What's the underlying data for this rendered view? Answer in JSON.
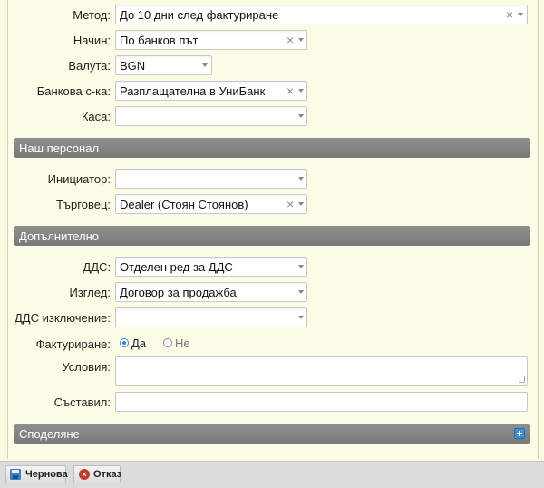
{
  "payment": {
    "method": {
      "label": "Метод:",
      "value": "До 10 дни след фактуриране"
    },
    "way": {
      "label": "Начин:",
      "value": "По банков път"
    },
    "currency": {
      "label": "Валута:",
      "value": "BGN"
    },
    "bank_account": {
      "label": "Банкова с-ка:",
      "value": "Разплащателна в УниБанк"
    },
    "cashbox": {
      "label": "Каса:",
      "value": ""
    }
  },
  "staff_section": {
    "title": "Наш персонал",
    "initiator": {
      "label": "Инициатор:",
      "value": ""
    },
    "dealer": {
      "label": "Търговец:",
      "value": "Dealer (Стоян Стоянов)"
    }
  },
  "extra_section": {
    "title": "Допълнително",
    "vat": {
      "label": "ДДС:",
      "value": "Отделен ред за ДДС"
    },
    "view": {
      "label": "Изглед:",
      "value": "Договор за продажба"
    },
    "vat_exemption": {
      "label": "ДДС изключение:",
      "value": ""
    },
    "invoicing": {
      "label": "Фактуриране:",
      "yes": "Да",
      "no": "Не",
      "selected": "yes"
    },
    "conditions": {
      "label": "Условия:",
      "value": ""
    },
    "author": {
      "label": "Съставил:",
      "value": ""
    }
  },
  "sharing_section": {
    "title": "Споделяне"
  },
  "footer": {
    "draft_label": "Чернова",
    "cancel_label": "Отказ"
  },
  "icons": {
    "clear": "×",
    "cancel_glyph": "×"
  },
  "colors": {
    "background": "#fcfbe6",
    "section_header": "#858585",
    "radio_accent": "#2f7fd1"
  }
}
